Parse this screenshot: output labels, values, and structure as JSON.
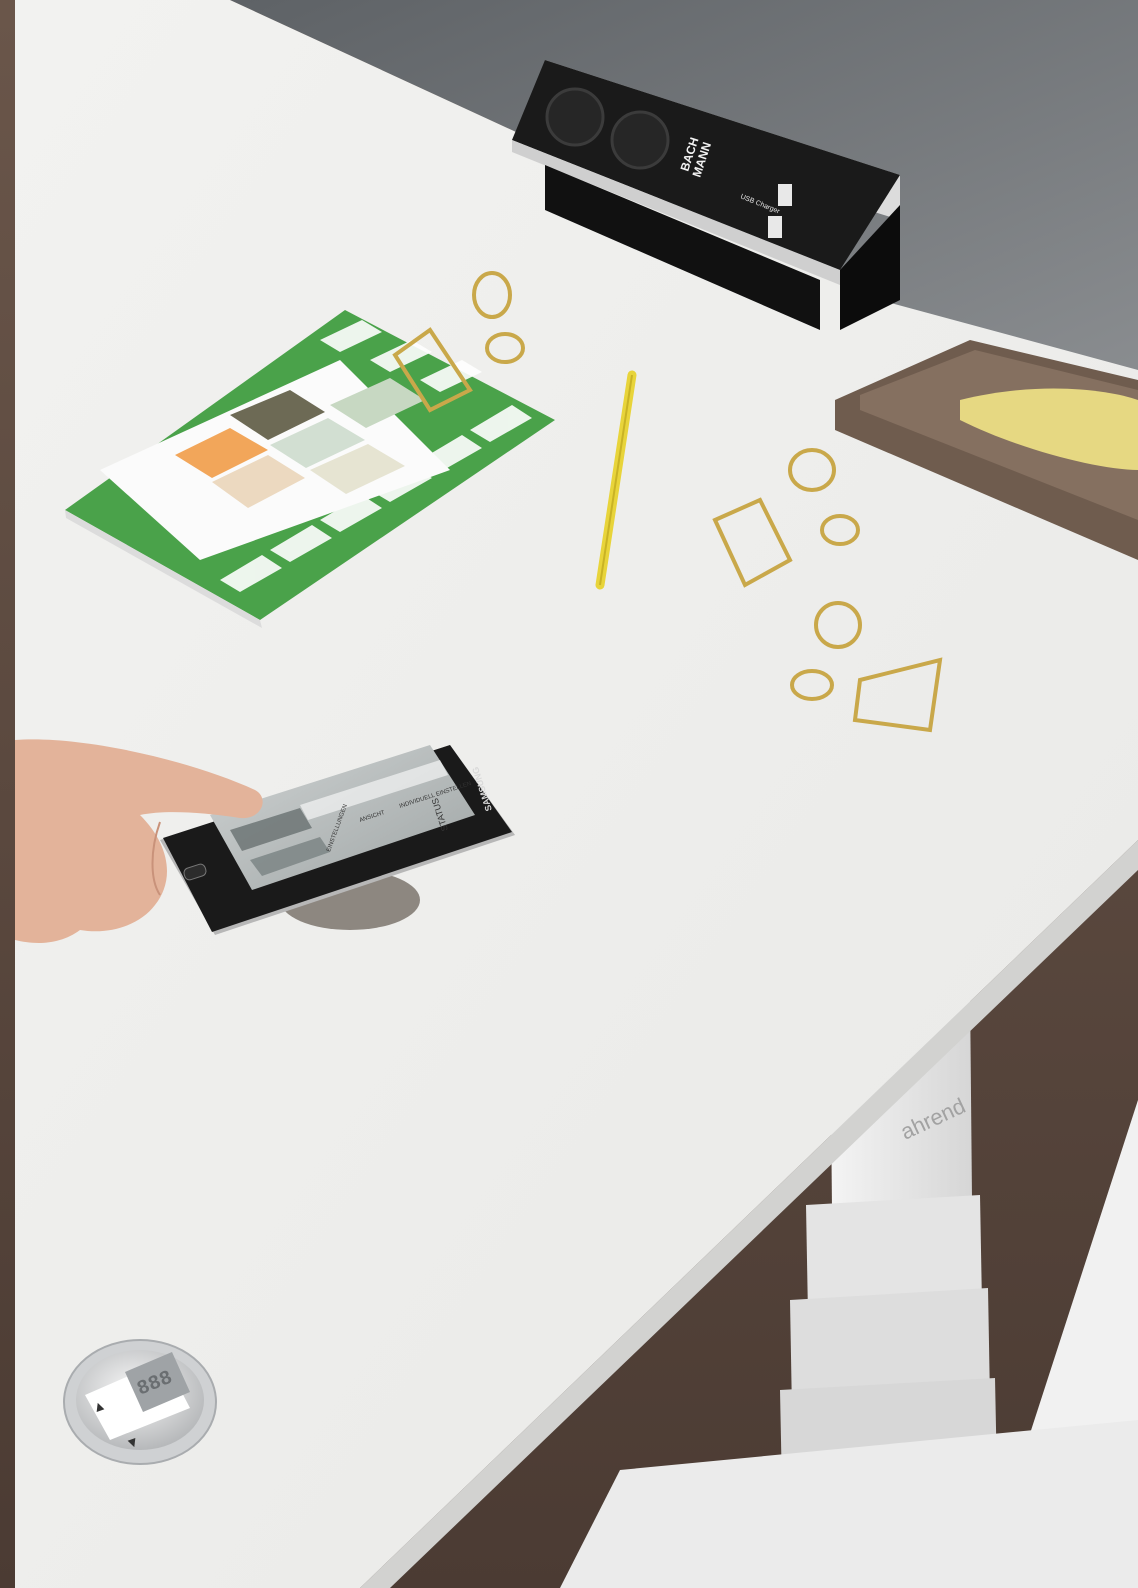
{
  "power_unit": {
    "brand_line1": "BACH",
    "brand_line2": "MANN",
    "usb_label": "USB Charger"
  },
  "phone": {
    "brand": "SAMSUNG",
    "screen": {
      "title": "STATUS",
      "field_text": "INDIVIDUELL EINSTELLEN",
      "menu_text": "ANSICHT",
      "side_text": "EINSTELLUNGEN"
    }
  },
  "table_leg": {
    "brand": "ahrend"
  },
  "desk_control": {
    "display": "888",
    "up_symbol": "▲",
    "down_symbol": "▲"
  }
}
